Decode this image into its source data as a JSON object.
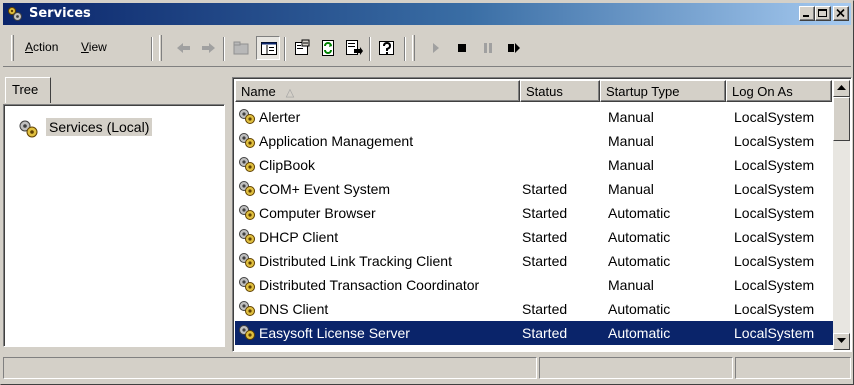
{
  "window": {
    "title": "Services",
    "controls": [
      "minimize",
      "maximize",
      "close"
    ]
  },
  "menu": {
    "action": {
      "accel": "A",
      "rest": "ction"
    },
    "view": {
      "accel": "V",
      "rest": "iew"
    }
  },
  "toolbar": {
    "icons": [
      "back-arrow-icon",
      "forward-arrow-icon",
      "up-level-icon",
      "show-hide-tree-icon",
      "properties-icon",
      "refresh-icon",
      "export-list-icon",
      "help-icon",
      "start-service-icon",
      "stop-service-icon",
      "pause-service-icon",
      "restart-service-icon"
    ]
  },
  "tree": {
    "tab_label": "Tree",
    "root_label": "Services (Local)"
  },
  "list": {
    "columns": {
      "name": "Name",
      "name_sort": "△",
      "status": "Status",
      "startup": "Startup Type",
      "logon": "Log On As"
    },
    "rows": [
      {
        "name": "Alerter",
        "status": "",
        "startup": "Manual",
        "logon": "LocalSystem"
      },
      {
        "name": "Application Management",
        "status": "",
        "startup": "Manual",
        "logon": "LocalSystem"
      },
      {
        "name": "ClipBook",
        "status": "",
        "startup": "Manual",
        "logon": "LocalSystem"
      },
      {
        "name": "COM+ Event System",
        "status": "Started",
        "startup": "Manual",
        "logon": "LocalSystem"
      },
      {
        "name": "Computer Browser",
        "status": "Started",
        "startup": "Automatic",
        "logon": "LocalSystem"
      },
      {
        "name": "DHCP Client",
        "status": "Started",
        "startup": "Automatic",
        "logon": "LocalSystem"
      },
      {
        "name": "Distributed Link Tracking Client",
        "status": "Started",
        "startup": "Automatic",
        "logon": "LocalSystem"
      },
      {
        "name": "Distributed Transaction Coordinator",
        "status": "",
        "startup": "Manual",
        "logon": "LocalSystem"
      },
      {
        "name": "DNS Client",
        "status": "Started",
        "startup": "Automatic",
        "logon": "LocalSystem"
      },
      {
        "name": "Easysoft License Server",
        "status": "Started",
        "startup": "Automatic",
        "logon": "LocalSystem",
        "selected": true
      }
    ]
  },
  "colors": {
    "title_start": "#0a246a",
    "title_end": "#a6caf0",
    "selection": "#0a246a",
    "face": "#d4d0c8"
  }
}
